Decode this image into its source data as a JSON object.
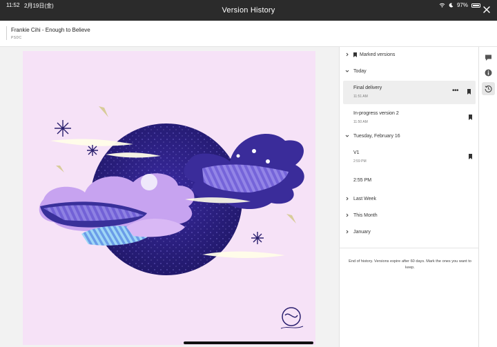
{
  "status_bar": {
    "time": "11:52",
    "date": "2月19日(金)",
    "battery": "97%",
    "icons": [
      "wifi-icon",
      "moon-icon",
      "battery-icon"
    ]
  },
  "window": {
    "title": "Version History",
    "close_icon": "close-icon"
  },
  "file": {
    "title": "Frankie Cihi - Enough to Believe",
    "type": "PSDC"
  },
  "panel": {
    "marked_versions_label": "Marked versions",
    "sections": {
      "today": "Today",
      "tuesday": "Tuesday, February 16",
      "last_week": "Last Week",
      "this_month": "This Month",
      "january": "January"
    },
    "versions": [
      {
        "name": "Final delivery",
        "time": "11:51 AM",
        "selected": true,
        "bookmarked": true
      },
      {
        "name": "In-progress version 2",
        "time": "11:50 AM",
        "selected": false,
        "bookmarked": true
      },
      {
        "name": "V1",
        "time": "2:59 PM",
        "selected": false,
        "bookmarked": true
      },
      {
        "name": "2:55 PM",
        "time": "",
        "selected": false,
        "bookmarked": false
      }
    ],
    "end_of_history": "End of history. Versions expire after 60 days. Mark the ones you want to keep."
  },
  "rail": {
    "buttons": [
      "comment-icon",
      "info-icon",
      "history-icon"
    ],
    "active": "history-icon"
  },
  "colors": {
    "titlebar": "#2b2b2b",
    "artwork_bg": "#f6e2f7",
    "selected_row": "#eeeeee"
  }
}
